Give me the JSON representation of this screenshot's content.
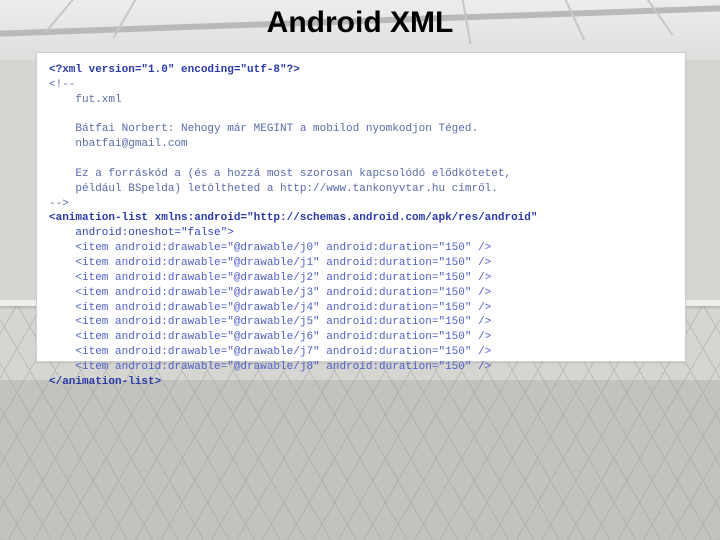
{
  "title": "Android XML",
  "xml": {
    "decl": "<?xml version=\"1.0\" encoding=\"utf-8\"?>",
    "comment_lines": [
      "<!--",
      "    fut.xml",
      "",
      "    Bátfai Norbert: Nehogy már MEGINT a mobilod nyomkodjon Téged.",
      "    nbatfai@gmail.com",
      "",
      "    Ez a forráskód a (és a hozzá most szorosan kapcsolódó elődkötetet,",
      "    például BSpelda) letöltheted a http://www.tankonyvtar.hu címről.",
      "-->"
    ],
    "root_open": "<animation-list xmlns:android=\"http://schemas.android.com/apk/res/android\"",
    "root_attr2": "    android:oneshot=\"false\">",
    "items": [
      {
        "line": "    <item android:drawable=\"@drawable/j0\" android:duration=\"150\" />"
      },
      {
        "line": "    <item android:drawable=\"@drawable/j1\" android:duration=\"150\" />"
      },
      {
        "line": "    <item android:drawable=\"@drawable/j2\" android:duration=\"150\" />"
      },
      {
        "line": "    <item android:drawable=\"@drawable/j3\" android:duration=\"150\" />"
      },
      {
        "line": "    <item android:drawable=\"@drawable/j4\" android:duration=\"150\" />"
      },
      {
        "line": "    <item android:drawable=\"@drawable/j5\" android:duration=\"150\" />"
      },
      {
        "line": "    <item android:drawable=\"@drawable/j6\" android:duration=\"150\" />"
      },
      {
        "line": "    <item android:drawable=\"@drawable/j7\" android:duration=\"150\" />"
      },
      {
        "line": "    <item android:drawable=\"@drawable/j8\" android:duration=\"150\" />"
      }
    ],
    "root_close": "</animation-list>"
  }
}
